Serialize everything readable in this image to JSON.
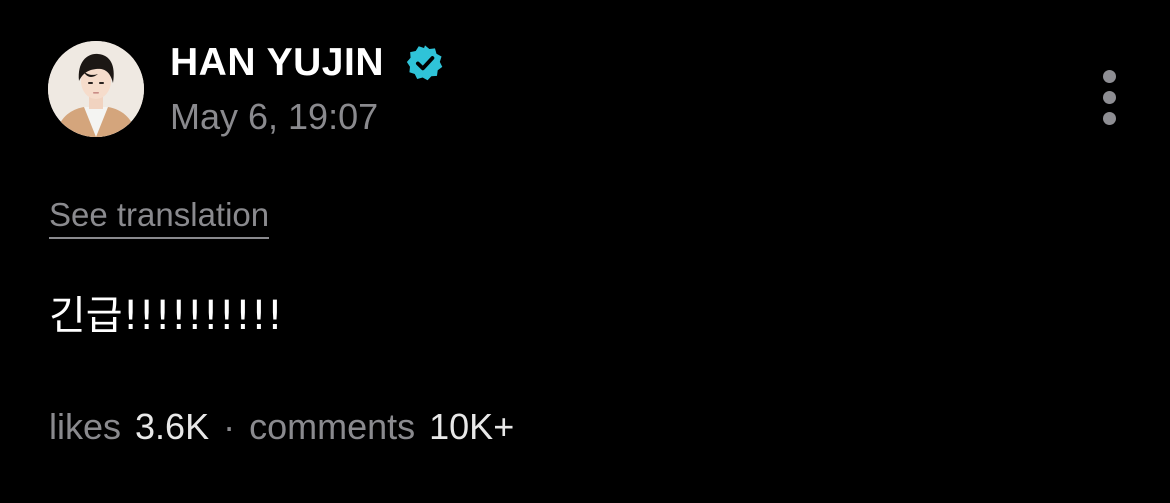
{
  "post": {
    "author": {
      "name": "HAN YUJIN",
      "verified": true,
      "verified_color": "#2fc3d8",
      "avatar_icon": "profile-photo"
    },
    "timestamp": "May 6, 19:07",
    "menu_icon": "more-vertical-icon",
    "translate_label": "See translation",
    "body": "긴급!!!!!!!!!!",
    "stats": {
      "likes_label": "likes",
      "likes_value": "3.6K",
      "separator": "·",
      "comments_label": "comments",
      "comments_value": "10K+"
    }
  }
}
